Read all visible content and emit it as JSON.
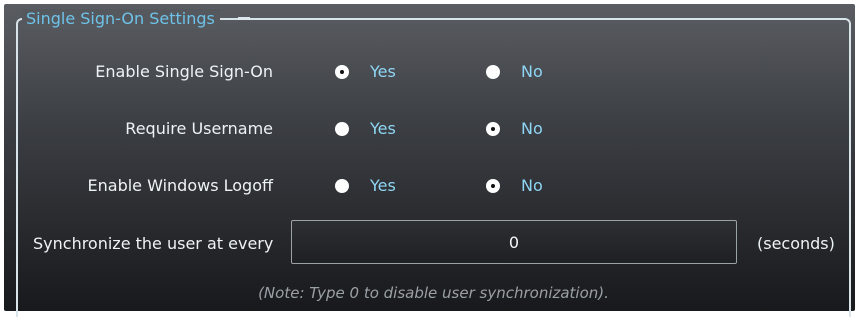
{
  "group": {
    "title": "Single Sign-On Settings"
  },
  "rows": [
    {
      "label": "Enable Single Sign-On",
      "yes_label": "Yes",
      "no_label": "No",
      "selected": "yes"
    },
    {
      "label": "Require Username",
      "yes_label": "Yes",
      "no_label": "No",
      "selected": "no"
    },
    {
      "label": "Enable Windows Logoff",
      "yes_label": "Yes",
      "no_label": "No",
      "selected": "no"
    }
  ],
  "sync": {
    "label": "Synchronize the user at every",
    "value": "0",
    "unit": "(seconds)"
  },
  "note": "(Note: Type 0 to disable user synchronization).",
  "colors": {
    "title": "#6fc3ea",
    "radio_label": "#8fd6f5",
    "text": "#eef3f6",
    "note": "#9aa1a6"
  }
}
